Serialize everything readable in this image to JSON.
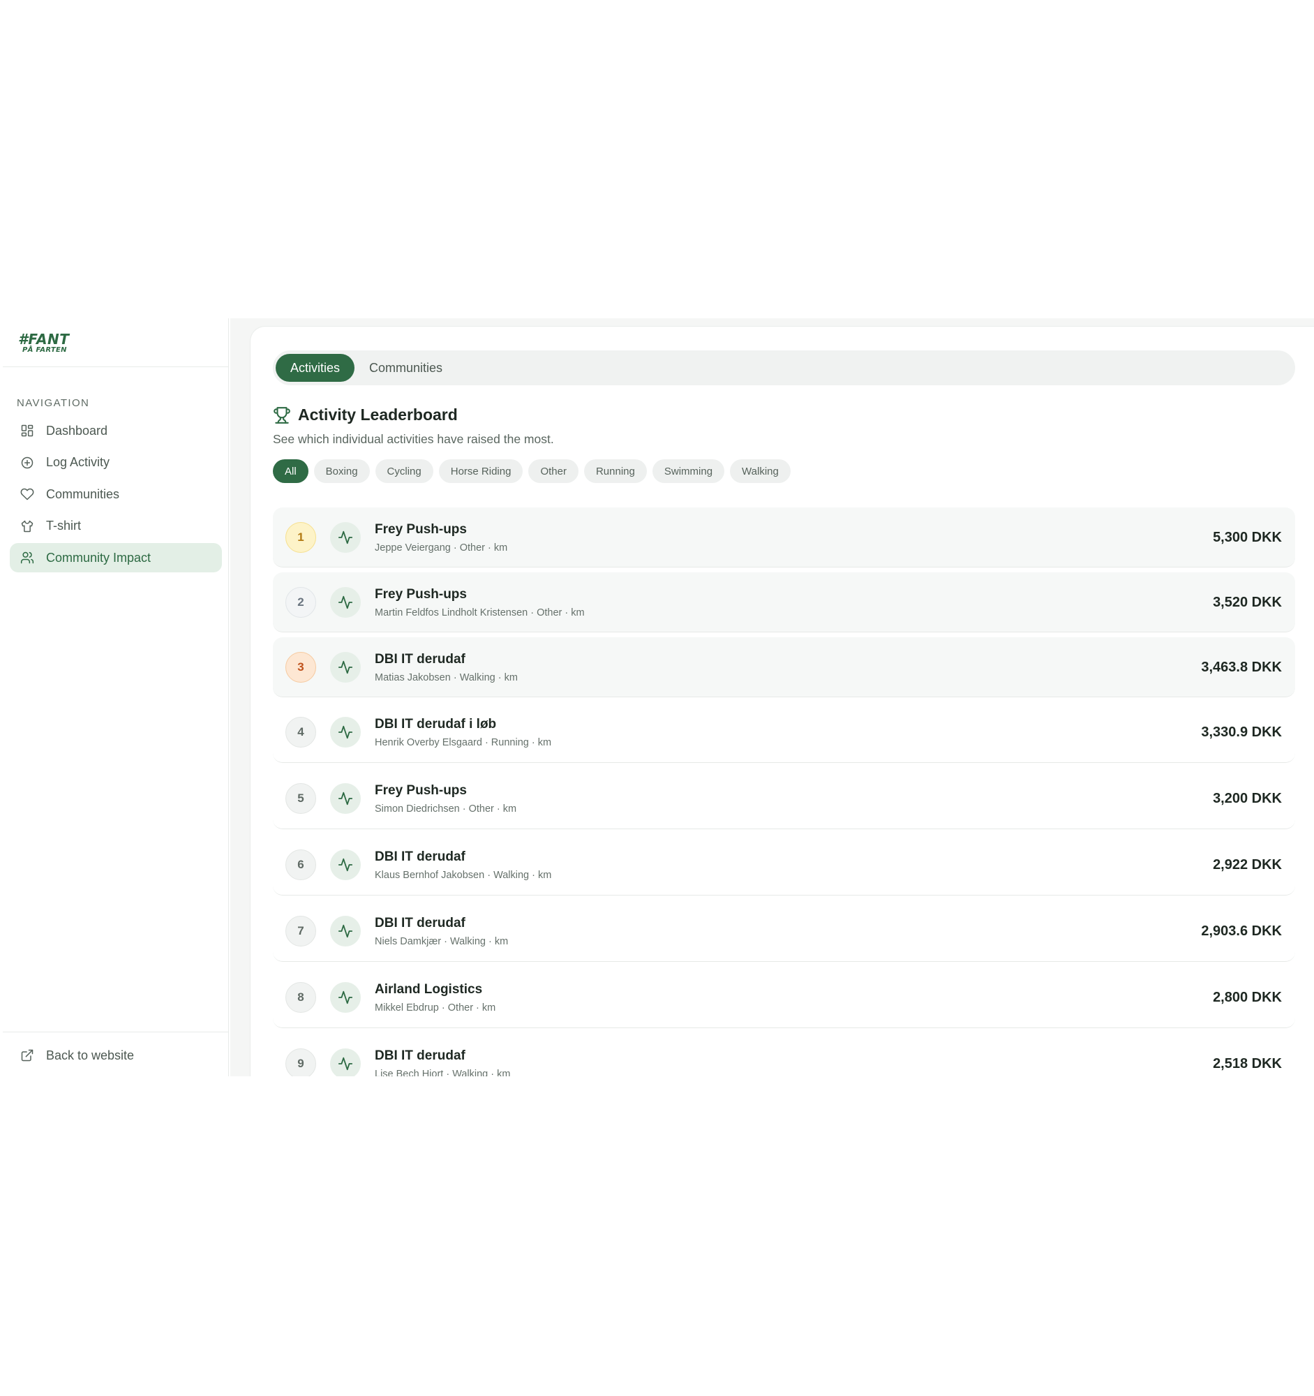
{
  "brand": {
    "logo_line1": "#FANT",
    "logo_line2": "PÅ FARTEN"
  },
  "sidebar": {
    "heading": "NAVIGATION",
    "items": [
      {
        "label": "Dashboard",
        "icon": "dashboard-icon"
      },
      {
        "label": "Log Activity",
        "icon": "plus-circle-icon"
      },
      {
        "label": "Communities",
        "icon": "heart-icon"
      },
      {
        "label": "T-shirt",
        "icon": "shirt-icon"
      },
      {
        "label": "Community Impact",
        "icon": "users-icon",
        "active": true
      }
    ],
    "footer_link": "Back to website"
  },
  "tabs": [
    {
      "label": "Activities",
      "active": true
    },
    {
      "label": "Communities",
      "active": false
    }
  ],
  "leaderboard": {
    "title": "Activity Leaderboard",
    "subtitle": "See which individual activities have raised the most.",
    "filters": [
      "All",
      "Boxing",
      "Cycling",
      "Horse Riding",
      "Other",
      "Running",
      "Swimming",
      "Walking"
    ],
    "active_filter": "All",
    "rows": [
      {
        "rank": "1",
        "title": "Frey Push-ups",
        "meta": "Jeppe Veiergang · Other · km",
        "amount": "5,300 DKK"
      },
      {
        "rank": "2",
        "title": "Frey Push-ups",
        "meta": "Martin Feldfos Lindholt Kristensen · Other · km",
        "amount": "3,520 DKK"
      },
      {
        "rank": "3",
        "title": "DBI IT derudaf",
        "meta": "Matias Jakobsen · Walking · km",
        "amount": "3,463.8 DKK"
      },
      {
        "rank": "4",
        "title": "DBI IT derudaf i løb",
        "meta": "Henrik Overby Elsgaard · Running · km",
        "amount": "3,330.9 DKK"
      },
      {
        "rank": "5",
        "title": "Frey Push-ups",
        "meta": "Simon Diedrichsen · Other · km",
        "amount": "3,200 DKK"
      },
      {
        "rank": "6",
        "title": "DBI IT derudaf",
        "meta": "Klaus Bernhof Jakobsen · Walking · km",
        "amount": "2,922 DKK"
      },
      {
        "rank": "7",
        "title": "DBI IT derudaf",
        "meta": "Niels Damkjær · Walking · km",
        "amount": "2,903.6 DKK"
      },
      {
        "rank": "8",
        "title": "Airland Logistics",
        "meta": "Mikkel Ebdrup · Other · km",
        "amount": "2,800 DKK"
      },
      {
        "rank": "9",
        "title": "DBI IT derudaf",
        "meta": "Lise Bech Hjort · Walking · km",
        "amount": "2,518 DKK"
      }
    ]
  },
  "colors": {
    "brand_green": "#2f6b45",
    "active_nav_bg": "#e3efe6",
    "gold": "#fdf3c8",
    "bronze": "#fde7d3"
  }
}
